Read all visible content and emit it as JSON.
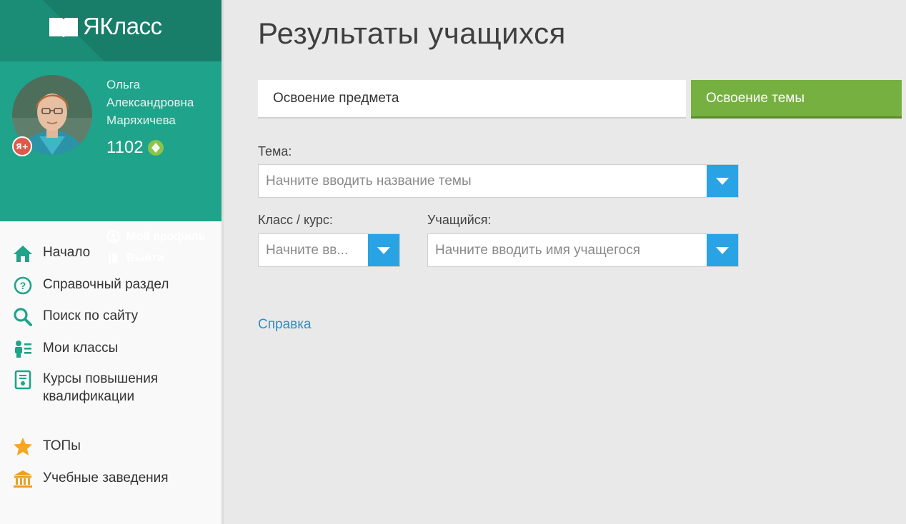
{
  "logo": {
    "text": "ЯКласс"
  },
  "profile": {
    "first_name": "Ольга",
    "middle_name": "Александровна",
    "last_name": "Маряхичева",
    "points": "1102",
    "badge": "Я+",
    "my_profile_label": "Мой профиль",
    "logout_label": "Выйти"
  },
  "nav": {
    "items": [
      {
        "label": "Начало",
        "icon": "home-icon"
      },
      {
        "label": "Справочный раздел",
        "icon": "question-circle-icon"
      },
      {
        "label": "Поиск по сайту",
        "icon": "search-icon"
      },
      {
        "label": "Мои классы",
        "icon": "classes-icon"
      },
      {
        "label_line1": "Курсы повышения",
        "label_line2": "квалификации",
        "icon": "certificate-icon"
      },
      {
        "label": "ТОПы",
        "icon": "star-icon"
      },
      {
        "label": "Учебные заведения",
        "icon": "institution-icon"
      }
    ]
  },
  "main": {
    "title": "Результаты учащихся",
    "tabs": [
      {
        "label": "Освоение предмета",
        "active": false
      },
      {
        "label": "Освоение темы",
        "active": true
      }
    ],
    "topic": {
      "label": "Тема:",
      "placeholder": "Начните вводить название темы",
      "value": ""
    },
    "class": {
      "label": "Класс / курс:",
      "placeholder": "Начните вв...",
      "value": ""
    },
    "student": {
      "label": "Учащийся:",
      "placeholder": "Начните вводить имя учащегося",
      "value": ""
    },
    "help_link": "Справка"
  },
  "colors": {
    "header_teal": "#1b8c76",
    "profile_teal": "#1fa38a",
    "active_tab_green": "#76b041",
    "dropdown_blue": "#2aa3e4",
    "link_blue": "#2e8fc7"
  }
}
